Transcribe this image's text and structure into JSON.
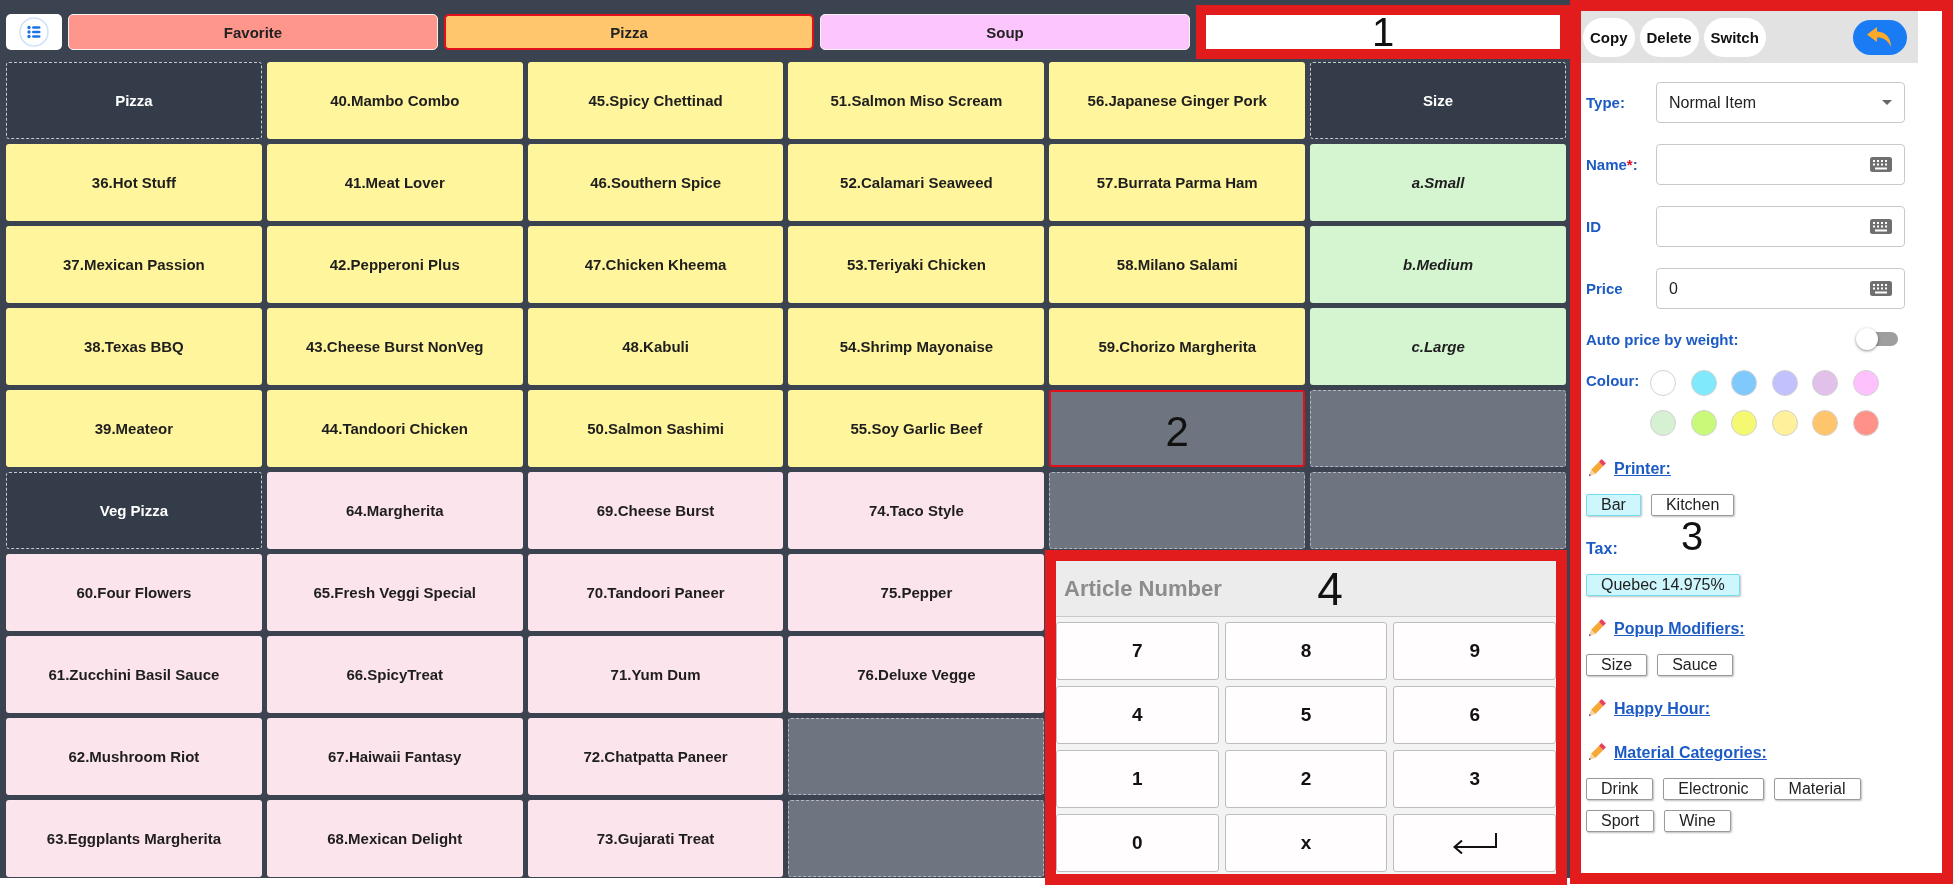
{
  "toolbar": {
    "tabs": [
      {
        "label": "Favorite",
        "color": "#ff968b",
        "selected": false
      },
      {
        "label": "Pizza",
        "color": "#ffc66e",
        "selected": true
      },
      {
        "label": "Soup",
        "color": "#fdc5fd",
        "selected": false
      }
    ],
    "callout": "1"
  },
  "grid": {
    "rows": [
      [
        {
          "kind": "category",
          "label": "Pizza",
          "selected": false
        },
        {
          "kind": "item",
          "label": "40.Mambo Combo",
          "color": "#fff59c",
          "selected": false
        },
        {
          "kind": "item",
          "label": "45.Spicy Chettinad",
          "color": "#fff59c",
          "selected": false
        },
        {
          "kind": "item",
          "label": "51.Salmon Miso Scream",
          "color": "#fff59c",
          "selected": false
        },
        {
          "kind": "item",
          "label": "56.Japanese Ginger Pork",
          "color": "#fff59c",
          "selected": false
        },
        {
          "kind": "category",
          "label": "Size",
          "selected": false
        }
      ],
      [
        {
          "kind": "item",
          "label": "36.Hot Stuff",
          "color": "#fff59c",
          "selected": false
        },
        {
          "kind": "item",
          "label": "41.Meat Lover",
          "color": "#fff59c",
          "selected": false
        },
        {
          "kind": "item",
          "label": "46.Southern Spice",
          "color": "#fff59c",
          "selected": false
        },
        {
          "kind": "item",
          "label": "52.Calamari Seaweed",
          "color": "#fff59c",
          "selected": false
        },
        {
          "kind": "item",
          "label": "57.Burrata Parma Ham",
          "color": "#fff59c",
          "selected": false
        },
        {
          "kind": "modifier",
          "label": "a.Small",
          "color": "#d5f5d1",
          "selected": false
        }
      ],
      [
        {
          "kind": "item",
          "label": "37.Mexican Passion",
          "color": "#fff59c",
          "selected": false
        },
        {
          "kind": "item",
          "label": "42.Pepperoni Plus",
          "color": "#fff59c",
          "selected": false
        },
        {
          "kind": "item",
          "label": "47.Chicken Kheema",
          "color": "#fff59c",
          "selected": false
        },
        {
          "kind": "item",
          "label": "53.Teriyaki Chicken",
          "color": "#fff59c",
          "selected": false
        },
        {
          "kind": "item",
          "label": "58.Milano Salami",
          "color": "#fff59c",
          "selected": false
        },
        {
          "kind": "modifier",
          "label": "b.Medium",
          "color": "#d5f5d1",
          "selected": false
        }
      ],
      [
        {
          "kind": "item",
          "label": "38.Texas BBQ",
          "color": "#fff59c",
          "selected": false
        },
        {
          "kind": "item",
          "label": "43.Cheese Burst NonVeg",
          "color": "#fff59c",
          "selected": false
        },
        {
          "kind": "item",
          "label": "48.Kabuli",
          "color": "#fff59c",
          "selected": false
        },
        {
          "kind": "item",
          "label": "54.Shrimp Mayonaise",
          "color": "#fff59c",
          "selected": false
        },
        {
          "kind": "item",
          "label": "59.Chorizo Margherita",
          "color": "#fff59c",
          "selected": false
        },
        {
          "kind": "modifier",
          "label": "c.Large",
          "color": "#d5f5d1",
          "selected": false
        }
      ],
      [
        {
          "kind": "item",
          "label": "39.Meateor",
          "color": "#fff59c",
          "selected": false
        },
        {
          "kind": "item",
          "label": "44.Tandoori Chicken",
          "color": "#fff59c",
          "selected": false
        },
        {
          "kind": "item",
          "label": "50.Salmon Sashimi",
          "color": "#fff59c",
          "selected": false
        },
        {
          "kind": "item",
          "label": "55.Soy Garlic Beef",
          "color": "#fff59c",
          "selected": false
        },
        {
          "kind": "empty",
          "selected": true,
          "callout": "2"
        },
        {
          "kind": "empty",
          "selected": false
        }
      ],
      [
        {
          "kind": "category",
          "label": "Veg Pizza",
          "selected": false
        },
        {
          "kind": "item",
          "label": "64.Margherita",
          "color": "#fce4ec",
          "selected": false
        },
        {
          "kind": "item",
          "label": "69.Cheese Burst",
          "color": "#fce4ec",
          "selected": false
        },
        {
          "kind": "item",
          "label": "74.Taco Style",
          "color": "#fce4ec",
          "selected": false
        },
        {
          "kind": "empty",
          "selected": false
        },
        {
          "kind": "empty",
          "selected": false
        }
      ],
      [
        {
          "kind": "item",
          "label": "60.Four Flowers",
          "color": "#fce4ec",
          "selected": false
        },
        {
          "kind": "item",
          "label": "65.Fresh Veggi Special",
          "color": "#fce4ec",
          "selected": false
        },
        {
          "kind": "item",
          "label": "70.Tandoori Paneer",
          "color": "#fce4ec",
          "selected": false
        },
        {
          "kind": "item",
          "label": "75.Pepper",
          "color": "#fce4ec",
          "selected": false
        }
      ],
      [
        {
          "kind": "item",
          "label": "61.Zucchini Basil Sauce",
          "color": "#fce4ec",
          "selected": false
        },
        {
          "kind": "item",
          "label": "66.SpicyTreat",
          "color": "#fce4ec",
          "selected": false
        },
        {
          "kind": "item",
          "label": "71.Yum Dum",
          "color": "#fce4ec",
          "selected": false
        },
        {
          "kind": "item",
          "label": "76.Deluxe Vegge",
          "color": "#fce4ec",
          "selected": false
        }
      ],
      [
        {
          "kind": "item",
          "label": "62.Mushroom Riot",
          "color": "#fce4ec",
          "selected": false
        },
        {
          "kind": "item",
          "label": "67.Haiwaii Fantasy",
          "color": "#fce4ec",
          "selected": false
        },
        {
          "kind": "item",
          "label": "72.Chatpatta Paneer",
          "color": "#fce4ec",
          "selected": false
        },
        {
          "kind": "empty",
          "selected": false
        }
      ],
      [
        {
          "kind": "item",
          "label": "63.Eggplants Margherita",
          "color": "#fce4ec",
          "selected": false
        },
        {
          "kind": "item",
          "label": "68.Mexican Delight",
          "color": "#fce4ec",
          "selected": false
        },
        {
          "kind": "item",
          "label": "73.Gujarati Treat",
          "color": "#fce4ec",
          "selected": false
        },
        {
          "kind": "empty",
          "selected": false
        }
      ]
    ]
  },
  "numpad": {
    "placeholder": "Article Number",
    "callout": "4",
    "keys": [
      {
        "kind": "text",
        "label": "7"
      },
      {
        "kind": "text",
        "label": "8"
      },
      {
        "kind": "text",
        "label": "9"
      },
      {
        "kind": "text",
        "label": "4"
      },
      {
        "kind": "text",
        "label": "5"
      },
      {
        "kind": "text",
        "label": "6"
      },
      {
        "kind": "text",
        "label": "1"
      },
      {
        "kind": "text",
        "label": "2"
      },
      {
        "kind": "text",
        "label": "3"
      },
      {
        "kind": "text",
        "label": "0"
      },
      {
        "kind": "text",
        "label": "x"
      },
      {
        "kind": "enter"
      }
    ]
  },
  "editor": {
    "callout": "3",
    "actions": [
      {
        "label": "Copy"
      },
      {
        "label": "Delete"
      },
      {
        "label": "Switch"
      }
    ],
    "fields": [
      {
        "kind": "select",
        "label": "Type:",
        "value": "Normal Item"
      },
      {
        "kind": "input",
        "label": "Name",
        "required_mark": "*",
        "label_suffix": ":"
      },
      {
        "kind": "input",
        "label": "ID"
      },
      {
        "kind": "input",
        "label": "Price",
        "value": "0"
      }
    ],
    "auto_price": {
      "label": "Auto price by weight:",
      "on": false
    },
    "colour": {
      "label": "Colour:",
      "swatches": [
        {
          "color": "#ffffff"
        },
        {
          "color": "#80e9fc"
        },
        {
          "color": "#80c9fc"
        },
        {
          "color": "#c1c1fd"
        },
        {
          "color": "#e1c1e9"
        },
        {
          "color": "#fdc1fd"
        },
        {
          "color": "#d5f1d1"
        },
        {
          "color": "#c9f979"
        },
        {
          "color": "#f5f971"
        },
        {
          "color": "#fff19b"
        },
        {
          "color": "#ffc56d"
        },
        {
          "color": "#ff9189"
        }
      ]
    },
    "sections": [
      {
        "kind": "link",
        "title": "Printer:",
        "chips": [
          {
            "label": "Bar",
            "selected": true
          },
          {
            "label": "Kitchen",
            "selected": false
          }
        ]
      },
      {
        "kind": "plain",
        "title": "Tax:",
        "chips": [
          {
            "label": "Quebec 14.975%",
            "selected": true
          }
        ]
      },
      {
        "kind": "link",
        "title": "Popup Modifiers:",
        "chips": [
          {
            "label": "Size",
            "selected": false
          },
          {
            "label": "Sauce",
            "selected": false
          }
        ]
      },
      {
        "kind": "link",
        "title": "Happy Hour:"
      },
      {
        "kind": "link",
        "title": "Material Categories:",
        "chips": [
          {
            "label": "Drink",
            "selected": false
          },
          {
            "label": "Electronic",
            "selected": false
          },
          {
            "label": "Material",
            "selected": false
          },
          {
            "label": "Sport",
            "selected": false
          },
          {
            "label": "Wine",
            "selected": false
          }
        ]
      }
    ]
  }
}
